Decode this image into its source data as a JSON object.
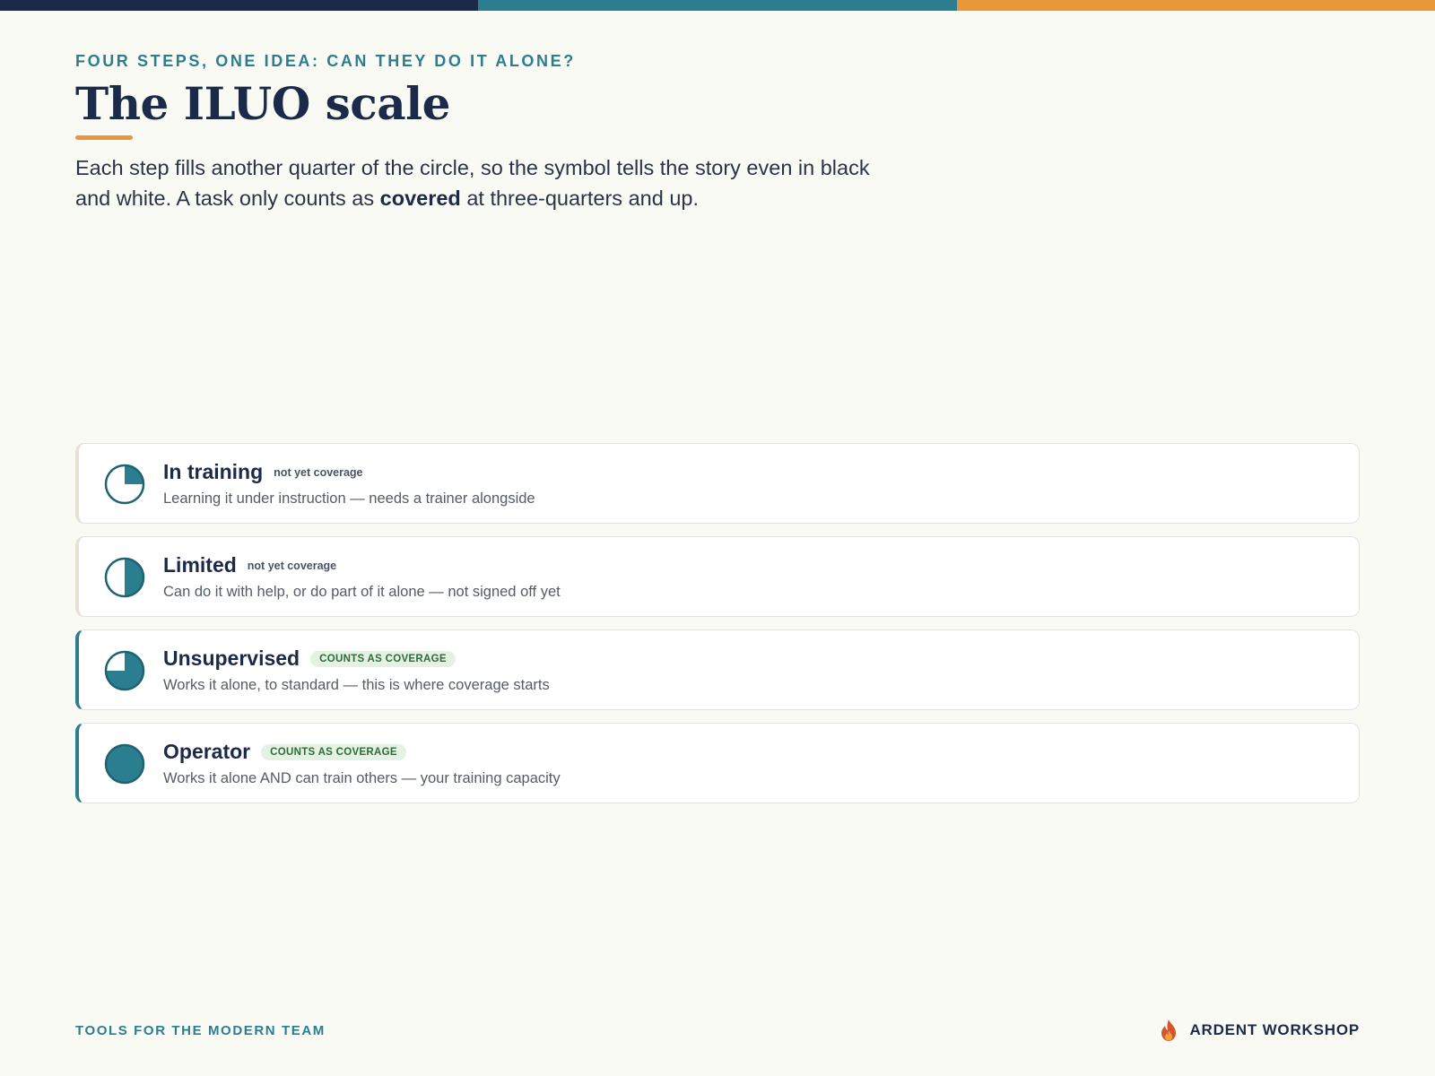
{
  "colors": {
    "navy": "#1c2a4a",
    "teal": "#2b7d90",
    "orange": "#e8983a"
  },
  "header": {
    "eyebrow": "FOUR STEPS, ONE IDEA: CAN THEY DO IT ALONE?",
    "title": "The ILUO scale",
    "lede_before": "Each step fills another quarter of the circle, so the symbol tells the story even in black and white. A task only counts as ",
    "lede_bold": "covered",
    "lede_after": " at three-quarters and up."
  },
  "levels": [
    {
      "name": "In training",
      "badge": "not yet coverage",
      "covered": false,
      "fill_quarters": 1,
      "description": "Learning it under instruction — needs a trainer alongside",
      "icon": "quarter-pie-icon"
    },
    {
      "name": "Limited",
      "badge": "not yet coverage",
      "covered": false,
      "fill_quarters": 2,
      "description": "Can do it with help, or do part of it alone — not signed off yet",
      "icon": "half-pie-icon"
    },
    {
      "name": "Unsupervised",
      "badge": "COUNTS AS COVERAGE",
      "covered": true,
      "fill_quarters": 3,
      "description": "Works it alone, to standard — this is where coverage starts",
      "icon": "three-quarter-pie-icon"
    },
    {
      "name": "Operator",
      "badge": "COUNTS AS COVERAGE",
      "covered": true,
      "fill_quarters": 4,
      "description": "Works it alone AND can train others — your training capacity",
      "icon": "full-pie-icon"
    }
  ],
  "footer": {
    "left": "TOOLS FOR THE MODERN TEAM",
    "brand": "ARDENT WORKSHOP",
    "brand_icon": "flame-icon"
  }
}
